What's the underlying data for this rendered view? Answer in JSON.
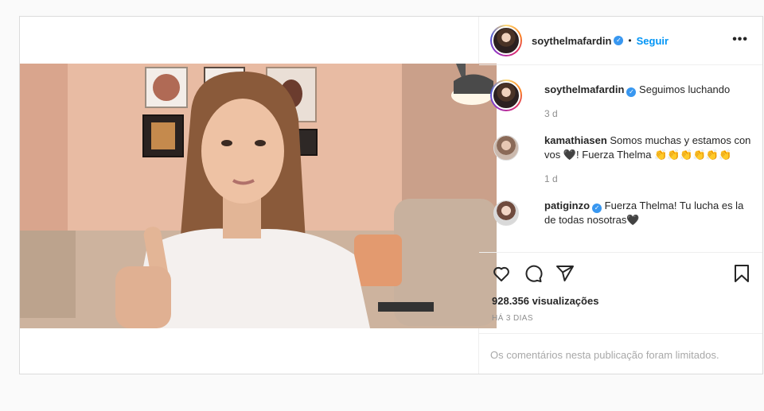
{
  "header": {
    "username": "soythelmafardin",
    "separator": "•",
    "follow_label": "Seguir",
    "more_label": "•••"
  },
  "comments": [
    {
      "username": "soythelmafardin",
      "text": "Seguimos luchando",
      "time": "3 d",
      "verified": true
    },
    {
      "username": "kamathiasen",
      "text": "Somos muchas y estamos con vos 🖤! Fuerza Thelma 👏👏👏👏👏👏",
      "time": "1 d",
      "verified": false
    },
    {
      "username": "patiginzo",
      "text": "Fuerza Thelma! Tu lucha es la de todas nosotras🖤",
      "time": "",
      "verified": true
    }
  ],
  "stats": {
    "views": "928.356 visualizações",
    "date": "HÁ 3 DIAS"
  },
  "footer": {
    "limited_text": "Os comentários nesta publicação foram limitados."
  },
  "icons": {
    "like": "heart-icon",
    "comment": "comment-icon",
    "share": "share-icon",
    "save": "bookmark-icon"
  },
  "colors": {
    "accent": "#0095f6",
    "verified": "#3897f0",
    "muted": "#8e8e8e"
  }
}
